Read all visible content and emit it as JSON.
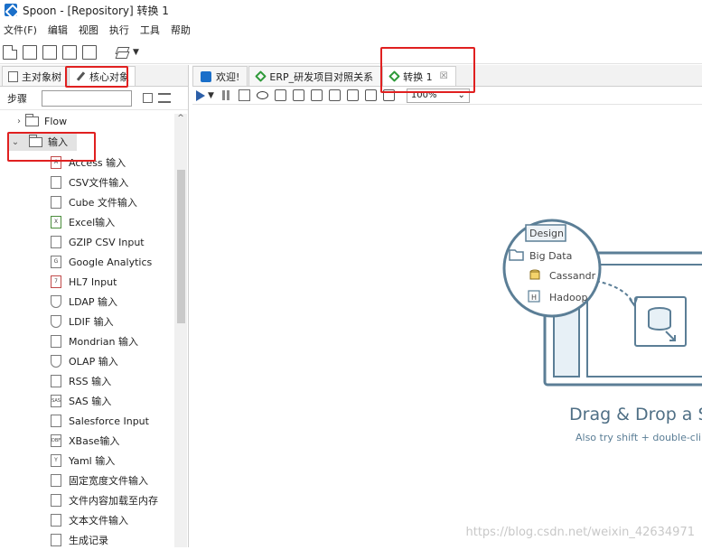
{
  "window": {
    "title": "Spoon - [Repository] 转换 1"
  },
  "menu": [
    "文件(F)",
    "编辑",
    "视图",
    "执行",
    "工具",
    "帮助"
  ],
  "left_tabs": [
    {
      "label": "主对象树",
      "active": false
    },
    {
      "label": "核心对象",
      "active": true
    }
  ],
  "steps": {
    "label": "步骤",
    "search_placeholder": ""
  },
  "tree": {
    "flow_label": "Flow",
    "input_label": "输入",
    "items": [
      {
        "label": "Access 输入",
        "icon": "A"
      },
      {
        "label": "CSV文件输入",
        "icon": ""
      },
      {
        "label": "Cube 文件输入",
        "icon": ""
      },
      {
        "label": "Excel输入",
        "icon": "X"
      },
      {
        "label": "GZIP CSV Input",
        "icon": ""
      },
      {
        "label": "Google Analytics",
        "icon": "G"
      },
      {
        "label": "HL7 Input",
        "icon": "7"
      },
      {
        "label": "LDAP 输入",
        "icon": ""
      },
      {
        "label": "LDIF 输入",
        "icon": ""
      },
      {
        "label": "Mondrian 输入",
        "icon": ""
      },
      {
        "label": "OLAP 输入",
        "icon": ""
      },
      {
        "label": "RSS 输入",
        "icon": ""
      },
      {
        "label": "SAS 输入",
        "icon": "SAS"
      },
      {
        "label": "Salesforce Input",
        "icon": ""
      },
      {
        "label": "XBase输入",
        "icon": "DBF"
      },
      {
        "label": "Yaml 输入",
        "icon": "Y"
      },
      {
        "label": "固定宽度文件输入",
        "icon": ""
      },
      {
        "label": "文件内容加载至内存",
        "icon": ""
      },
      {
        "label": "文本文件输入",
        "icon": ""
      },
      {
        "label": "生成记录",
        "icon": ""
      }
    ]
  },
  "right_tabs": [
    {
      "label": "欢迎!",
      "icon": "blue",
      "closable": false,
      "active": false
    },
    {
      "label": "ERP_研发项目对照关系",
      "icon": "green",
      "closable": false,
      "active": false
    },
    {
      "label": "转换 1",
      "icon": "green",
      "closable": true,
      "active": true
    }
  ],
  "zoom": "100%",
  "canvas_hint": {
    "design_tab": "Design",
    "big_data": "Big Data",
    "cassandra": "Cassandr",
    "hadoop": "Hadoop",
    "headline": "Drag & Drop a St",
    "subline": "Also try shift + double-cli"
  },
  "watermark": "https://blog.csdn.net/weixin_42634971",
  "colors": {
    "highlight": "#e02020",
    "accent": "#1a6fc9",
    "illustration": "#5b7e96"
  }
}
